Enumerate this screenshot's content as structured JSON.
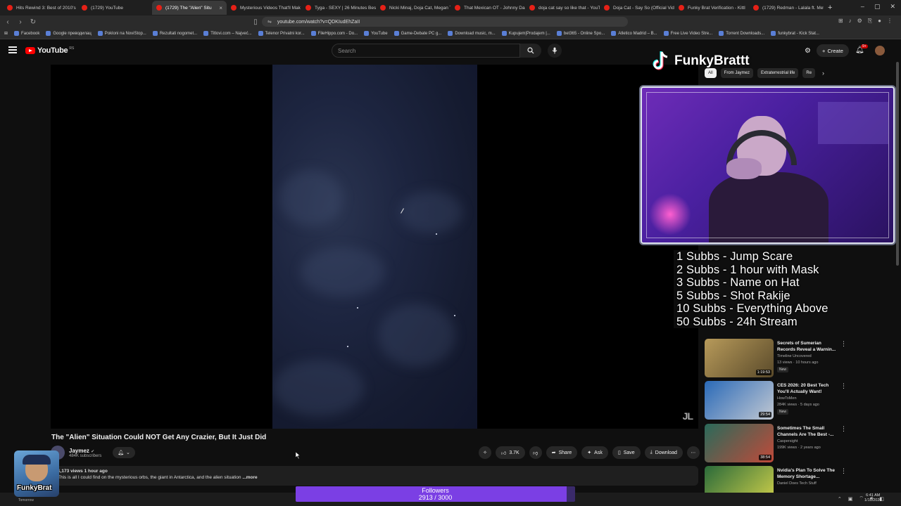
{
  "browser": {
    "tabs": [
      {
        "label": "Hits Rewind 3: Best of 2010's H",
        "active": false
      },
      {
        "label": "(1729) YouTube",
        "active": false
      },
      {
        "label": "(1729) The \"Alien\" Situ",
        "active": true
      },
      {
        "label": "Mysterious Videos That'll Mak",
        "active": false
      },
      {
        "label": "Tyga - SEXY | 26 Minutes Best",
        "active": false
      },
      {
        "label": "Nicki Minaj, Doja Cat, Megan T",
        "active": false
      },
      {
        "label": "That Mexican OT - Johnny Dan",
        "active": false
      },
      {
        "label": "doja cat say so like that - YouT",
        "active": false
      },
      {
        "label": "Doja Cat - Say So (Official Vide",
        "active": false
      },
      {
        "label": "Funky Brat Verification - Kittl",
        "active": false
      },
      {
        "label": "(1729) Redman - Lalala ft. Met",
        "active": false
      }
    ],
    "url": "youtube.com/watch?v=QDKIudEhZaII",
    "bookmarks": [
      "Facebook",
      "Google преводилац",
      "Pokloni na NoviStop...",
      "Rezultati nogomet...",
      "Titlovi.com – Najveć...",
      "Telenor Privatni kor...",
      "FileHippo.com - Do...",
      "YouTube",
      "Game-Debate PC g...",
      "Download music, m...",
      "Kupujem|Prodajem |...",
      "bet365 - Online Spo...",
      "Atletico Madrid – B...",
      "Free Live Video Stre...",
      "Torrent Downloads...",
      "funkybrat - Kick Stat..."
    ]
  },
  "youtube": {
    "region": "RS",
    "search_placeholder": "Search",
    "create_label": "Create",
    "notif_count": "9+",
    "video": {
      "title": "The \"Alien\" Situation Could NOT Get Any Crazier, But It Just Did",
      "watermark": "JL",
      "channel": "Jaymez",
      "subscribers": "484K subscribers",
      "likes": "3.7K",
      "share": "Share",
      "ask": "Ask",
      "save": "Save",
      "download": "Download",
      "views_meta": "1,173 views  1 hour ago",
      "description": "This is all I could find on the mysterious orbs, the giant in Antarctica, and the alien situation",
      "more": "...more"
    },
    "chips": [
      "All",
      "From Jaymez",
      "Extraterrestrial life",
      "Re"
    ],
    "recommendations": [
      {
        "title": "Secrets of Sumerian Records Reveal a Warnin...",
        "channel": "Timeline Uncovered",
        "views": "13 views · 10 hours ago",
        "badge": "New",
        "duration": "1:19:53",
        "colors": [
          "#b79a5a",
          "#5a4a2a"
        ]
      },
      {
        "title": "CES 2026: 20 Best Tech You'll Actually Want!",
        "channel": "HowToMen",
        "views": "284K views · 5 days ago",
        "badge": "New",
        "duration": "29:54",
        "colors": [
          "#2a6ab8",
          "#c2c8d2"
        ]
      },
      {
        "title": "Sometimes The Small Channels Are The Best -...",
        "channel": "Caspersight",
        "views": "199K views · 2 years ago",
        "badge": "",
        "duration": "38:54",
        "colors": [
          "#2a6a5a",
          "#c04a3a"
        ]
      },
      {
        "title": "Nvidia's Plan To Solve The Memory Shortage...",
        "channel": "Daniel Does Tech Stuff",
        "views": "",
        "badge": "",
        "duration": "",
        "colors": [
          "#2a6a3a",
          "#d0d04a"
        ]
      }
    ]
  },
  "stream": {
    "streamer_name": "FunkyBrattt",
    "sub_goals": [
      "1 Subbs - Jump Scare",
      "2 Subbs - 1 hour with Mask",
      "3 Subbs - Name on Hat",
      "5 Subbs - Shot Rakije",
      "10 Subbs - Everything Above",
      "50 Subbs - 24h Stream"
    ],
    "logo_text": "FunkyBrat",
    "tomorrow_text": "Tomorrow",
    "followers_label": "Followers",
    "followers_current": 2913,
    "followers_goal": 3000,
    "followers_text": "2913 / 3000"
  },
  "taskbar": {
    "time": "6:41 AM",
    "date": "1/16/2026"
  }
}
